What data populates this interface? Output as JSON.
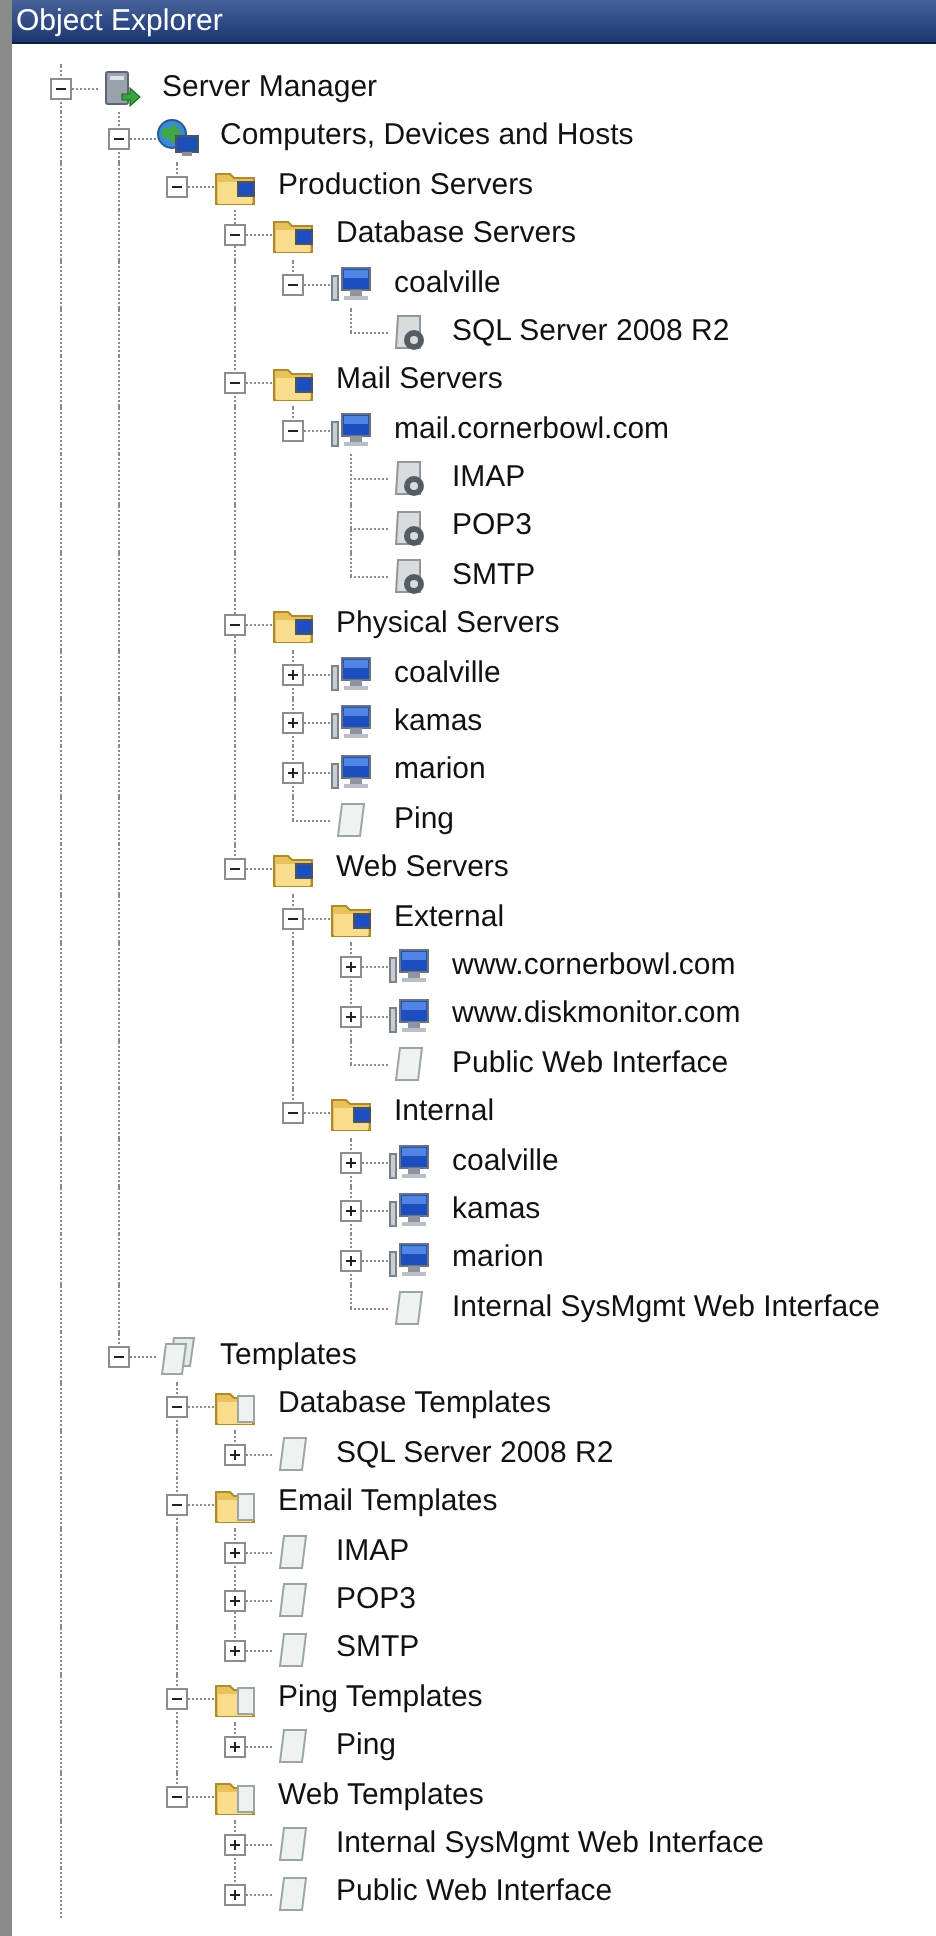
{
  "window": {
    "title": "Object Explorer"
  },
  "tree": [
    {
      "label": "Server Manager",
      "kind": "manager",
      "expanded": true,
      "more_below": true,
      "children": [
        {
          "label": "Computers, Devices and Hosts",
          "kind": "network",
          "expanded": true,
          "children": [
            {
              "label": "Production Servers",
              "kind": "server-folder",
              "expanded": true,
              "children": [
                {
                  "label": "Database Servers",
                  "kind": "server-folder",
                  "expanded": true,
                  "children": [
                    {
                      "label": "coalville",
                      "kind": "computer",
                      "expanded": true,
                      "children": [
                        {
                          "label": "SQL Server 2008 R2",
                          "kind": "service"
                        }
                      ]
                    }
                  ]
                },
                {
                  "label": "Mail Servers",
                  "kind": "server-folder",
                  "expanded": true,
                  "children": [
                    {
                      "label": "mail.cornerbowl.com",
                      "kind": "computer",
                      "expanded": true,
                      "children": [
                        {
                          "label": "IMAP",
                          "kind": "service"
                        },
                        {
                          "label": "POP3",
                          "kind": "service"
                        },
                        {
                          "label": "SMTP",
                          "kind": "service"
                        }
                      ]
                    }
                  ]
                },
                {
                  "label": "Physical Servers",
                  "kind": "server-folder",
                  "expanded": true,
                  "children": [
                    {
                      "label": "coalville",
                      "kind": "computer",
                      "expanded": false
                    },
                    {
                      "label": "kamas",
                      "kind": "computer",
                      "expanded": false
                    },
                    {
                      "label": "marion",
                      "kind": "computer",
                      "expanded": false
                    },
                    {
                      "label": "Ping",
                      "kind": "document"
                    }
                  ]
                },
                {
                  "label": "Web Servers",
                  "kind": "server-folder",
                  "expanded": true,
                  "children": [
                    {
                      "label": "External",
                      "kind": "server-folder",
                      "expanded": true,
                      "children": [
                        {
                          "label": "www.cornerbowl.com",
                          "kind": "computer",
                          "expanded": false
                        },
                        {
                          "label": "www.diskmonitor.com",
                          "kind": "computer",
                          "expanded": false
                        },
                        {
                          "label": "Public Web Interface",
                          "kind": "document"
                        }
                      ]
                    },
                    {
                      "label": "Internal",
                      "kind": "server-folder",
                      "expanded": true,
                      "children": [
                        {
                          "label": "coalville",
                          "kind": "computer",
                          "expanded": false
                        },
                        {
                          "label": "kamas",
                          "kind": "computer",
                          "expanded": false
                        },
                        {
                          "label": "marion",
                          "kind": "computer",
                          "expanded": false
                        },
                        {
                          "label": "Internal SysMgmt Web Interface",
                          "kind": "document"
                        }
                      ]
                    }
                  ]
                }
              ]
            }
          ]
        },
        {
          "label": "Templates",
          "kind": "documents",
          "expanded": true,
          "children": [
            {
              "label": "Database Templates",
              "kind": "template-folder",
              "expanded": true,
              "children": [
                {
                  "label": "SQL Server 2008 R2",
                  "kind": "document",
                  "expanded": false
                }
              ]
            },
            {
              "label": "Email Templates",
              "kind": "template-folder",
              "expanded": true,
              "children": [
                {
                  "label": "IMAP",
                  "kind": "document",
                  "expanded": false
                },
                {
                  "label": "POP3",
                  "kind": "document",
                  "expanded": false
                },
                {
                  "label": "SMTP",
                  "kind": "document",
                  "expanded": false
                }
              ]
            },
            {
              "label": "Ping Templates",
              "kind": "template-folder",
              "expanded": true,
              "children": [
                {
                  "label": "Ping",
                  "kind": "document",
                  "expanded": false
                }
              ]
            },
            {
              "label": "Web Templates",
              "kind": "template-folder",
              "expanded": true,
              "children": [
                {
                  "label": "Internal SysMgmt Web Interface",
                  "kind": "document",
                  "expanded": false
                },
                {
                  "label": "Public Web Interface",
                  "kind": "document",
                  "expanded": false
                }
              ]
            }
          ]
        }
      ]
    }
  ]
}
